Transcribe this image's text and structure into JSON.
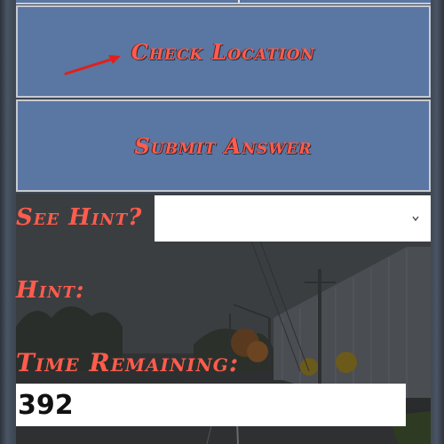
{
  "buttons": {
    "check_location": "Check Location",
    "submit_answer": "Submit Answer"
  },
  "hint": {
    "see_hint_label": "See Hint?",
    "selected_value": "",
    "hint_label": "Hint:"
  },
  "timer": {
    "label": "Time Remaining:",
    "value": "392"
  },
  "icons": {
    "arrow": "red-arrow-icon",
    "dropdown": "chevron-down-icon"
  },
  "colors": {
    "button_bg": "#5a76a2",
    "label_red": "#ff5c4d",
    "arrow": "#e0201c"
  }
}
